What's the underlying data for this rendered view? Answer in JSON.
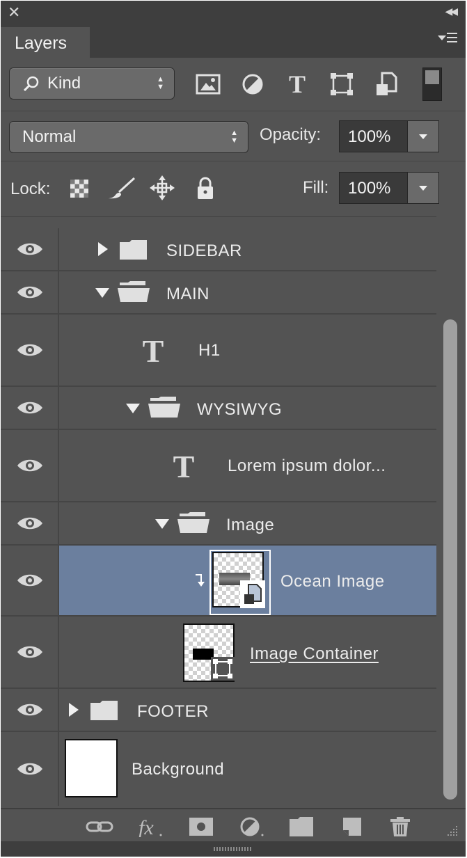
{
  "panel": {
    "tab_label": "Layers",
    "close_glyph": "✕",
    "collapse_glyph": "◀◀"
  },
  "filter": {
    "kind_label": "Kind",
    "icons": [
      "image-filter-icon",
      "adjustment-filter-icon",
      "type-filter-icon",
      "shape-filter-icon",
      "smart-object-filter-icon"
    ]
  },
  "blend": {
    "mode": "Normal",
    "opacity_label": "Opacity:",
    "opacity_value": "100%"
  },
  "lock": {
    "label": "Lock:",
    "fill_label": "Fill:",
    "fill_value": "100%"
  },
  "layers": [
    {
      "name": "SIDEBAR",
      "kind": "group",
      "expanded": false,
      "depth": 1
    },
    {
      "name": "MAIN",
      "kind": "group",
      "expanded": true,
      "depth": 1
    },
    {
      "name": "H1",
      "kind": "text",
      "depth": 2
    },
    {
      "name": "WYSIWYG",
      "kind": "group",
      "expanded": true,
      "depth": 2
    },
    {
      "name": "Lorem ipsum dolor...",
      "kind": "text",
      "depth": 3
    },
    {
      "name": "Image",
      "kind": "group",
      "expanded": true,
      "depth": 3
    },
    {
      "name": "Ocean Image",
      "kind": "smart-object",
      "depth": 4,
      "selected": true,
      "clipped": true
    },
    {
      "name": "Image Container",
      "kind": "shape",
      "depth": 4
    },
    {
      "name": "FOOTER",
      "kind": "group",
      "expanded": false,
      "depth": 0
    },
    {
      "name": "Background",
      "kind": "pixel",
      "depth": 0
    }
  ],
  "colors": {
    "panel_bg": "#535353",
    "header_bg": "#3e3e3e",
    "selected_row": "#6b7f9e",
    "text": "#ececec"
  }
}
